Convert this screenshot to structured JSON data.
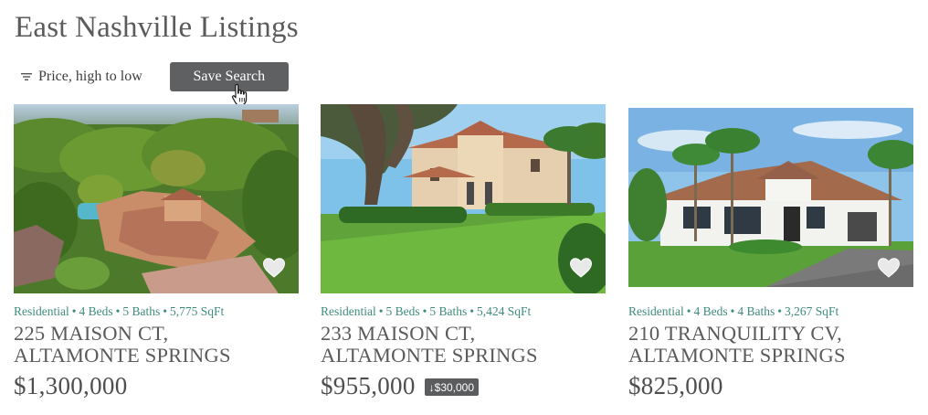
{
  "header": {
    "title": "East Nashville Listings"
  },
  "toolbar": {
    "sort_icon": "filter-lines-icon",
    "sort_label": "Price, high to low",
    "save_label": "Save Search",
    "save_bg": "#5f6062"
  },
  "accent_color": "#3e8c7d",
  "listings": [
    {
      "type": "Residential",
      "beds": "4 Beds",
      "baths": "5 Baths",
      "sqft": "5,775 SqFt",
      "address_line1": "225 MAISON CT,",
      "address_line2": "ALTAMONTE SPRINGS",
      "price": "$1,300,000",
      "price_drop": null,
      "favorite_icon": "heart-icon"
    },
    {
      "type": "Residential",
      "beds": "5 Beds",
      "baths": "5 Baths",
      "sqft": "5,424 SqFt",
      "address_line1": "233 MAISON CT,",
      "address_line2": "ALTAMONTE SPRINGS",
      "price": "$955,000",
      "price_drop": "↓$30,000",
      "favorite_icon": "heart-icon"
    },
    {
      "type": "Residential",
      "beds": "4 Beds",
      "baths": "4 Baths",
      "sqft": "3,267 SqFt",
      "address_line1": "210 TRANQUILITY CV,",
      "address_line2": "ALTAMONTE SPRINGS",
      "price": "$825,000",
      "price_drop": null,
      "favorite_icon": "heart-icon"
    }
  ],
  "meta_separator": "•"
}
